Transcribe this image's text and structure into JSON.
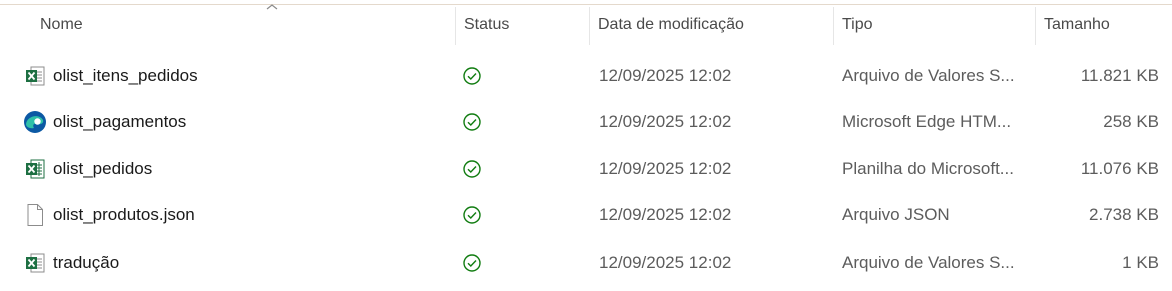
{
  "columns": {
    "name": "Nome",
    "status": "Status",
    "date": "Data de modificação",
    "type": "Tipo",
    "size": "Tamanho"
  },
  "sort": {
    "column": "name",
    "direction": "ascending"
  },
  "colors": {
    "status_ok": "#107c10",
    "excel_green": "#1d6f42",
    "edge_blue": "#0c59a4",
    "edge_teal": "#2fc0a8"
  },
  "files": [
    {
      "name": "olist_itens_pedidos",
      "icon": "excel-csv-icon",
      "status": "sync-ok-icon",
      "date": "12/09/2025 12:02",
      "type": "Arquivo de Valores S...",
      "size": "11.821 KB"
    },
    {
      "name": "olist_pagamentos",
      "icon": "edge-html-icon",
      "status": "sync-ok-icon",
      "date": "12/09/2025 12:02",
      "type": "Microsoft Edge HTM...",
      "size": "258 KB"
    },
    {
      "name": "olist_pedidos",
      "icon": "excel-workbook-icon",
      "status": "sync-ok-icon",
      "date": "12/09/2025 12:02",
      "type": "Planilha do Microsoft...",
      "size": "11.076 KB"
    },
    {
      "name": "olist_produtos.json",
      "icon": "generic-file-icon",
      "status": "sync-ok-icon",
      "date": "12/09/2025 12:02",
      "type": "Arquivo JSON",
      "size": "2.738 KB"
    },
    {
      "name": "tradução",
      "icon": "excel-csv-icon",
      "status": "sync-ok-icon",
      "date": "12/09/2025 12:02",
      "type": "Arquivo de Valores S...",
      "size": "1 KB"
    }
  ]
}
